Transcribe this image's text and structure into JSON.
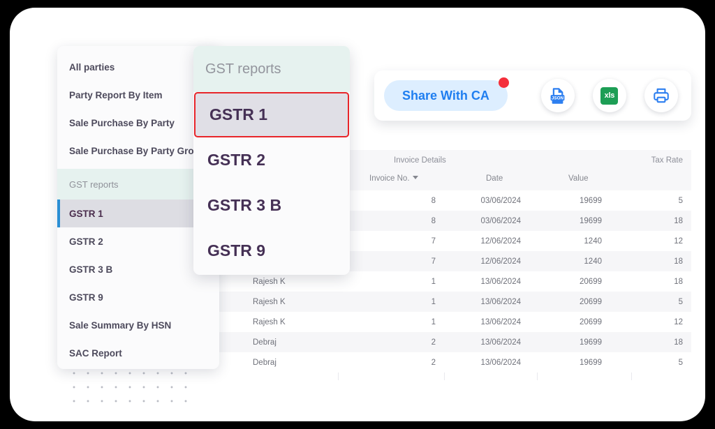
{
  "sidebar": {
    "items": [
      {
        "label": "All parties",
        "type": "item",
        "active": false
      },
      {
        "label": "Party Report By Item",
        "type": "item",
        "active": false
      },
      {
        "label": "Sale Purchase By Party",
        "type": "item",
        "active": false
      },
      {
        "label": "Sale Purchase By Party Group",
        "type": "item",
        "active": false
      },
      {
        "label": "GST reports",
        "type": "section",
        "active": false
      },
      {
        "label": "GSTR 1",
        "type": "item",
        "active": true
      },
      {
        "label": "GSTR 2",
        "type": "item",
        "active": false
      },
      {
        "label": "GSTR 3 B",
        "type": "item",
        "active": false
      },
      {
        "label": "GSTR 9",
        "type": "item",
        "active": false
      },
      {
        "label": "Sale Summary By HSN",
        "type": "item",
        "active": false
      },
      {
        "label": "SAC Report",
        "type": "item",
        "active": false
      }
    ]
  },
  "dropdown": {
    "header": "GST reports",
    "items": [
      {
        "label": "GSTR 1",
        "selected": true
      },
      {
        "label": "GSTR 2",
        "selected": false
      },
      {
        "label": "GSTR 3 B",
        "selected": false
      },
      {
        "label": "GSTR 9",
        "selected": false
      }
    ]
  },
  "toolbar": {
    "share_label": "Share With CA",
    "badge": "",
    "json_label": "JSON",
    "xls_label": "xls",
    "print_label": "Print"
  },
  "table": {
    "group_headers": {
      "invoice_details": "Invoice Details",
      "tax_rate": "Tax Rate"
    },
    "columns": {
      "invoice_no": "Invoice No.",
      "date": "Date",
      "value": "Value"
    },
    "rows": [
      {
        "party": "",
        "invoice_no": "8",
        "date": "03/06/2024",
        "value": "19699",
        "tax_rate": "5"
      },
      {
        "party": "",
        "invoice_no": "8",
        "date": "03/06/2024",
        "value": "19699",
        "tax_rate": "18"
      },
      {
        "party": "",
        "invoice_no": "7",
        "date": "12/06/2024",
        "value": "1240",
        "tax_rate": "12"
      },
      {
        "party": "",
        "invoice_no": "7",
        "date": "12/06/2024",
        "value": "1240",
        "tax_rate": "18"
      },
      {
        "party": "Rajesh K",
        "invoice_no": "1",
        "date": "13/06/2024",
        "value": "20699",
        "tax_rate": "18"
      },
      {
        "party": "Rajesh K",
        "invoice_no": "1",
        "date": "13/06/2024",
        "value": "20699",
        "tax_rate": "5"
      },
      {
        "party": "Rajesh K",
        "invoice_no": "1",
        "date": "13/06/2024",
        "value": "20699",
        "tax_rate": "12"
      },
      {
        "party": "Debraj",
        "invoice_no": "2",
        "date": "13/06/2024",
        "value": "19699",
        "tax_rate": "18"
      },
      {
        "party": "Debraj",
        "invoice_no": "2",
        "date": "13/06/2024",
        "value": "19699",
        "tax_rate": "5"
      }
    ]
  },
  "colors": {
    "accent_blue": "#1f7ef0",
    "badge_red": "#f42f3b",
    "selection_red": "#e8252a",
    "section_mint": "#e6f2ef",
    "xls_green": "#1d9e55",
    "active_bar_blue": "#2a8fd4"
  }
}
